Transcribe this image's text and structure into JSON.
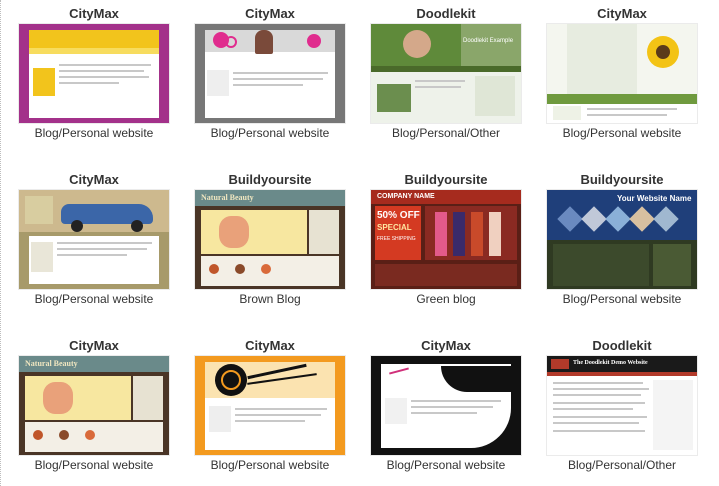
{
  "templates": [
    {
      "provider": "CityMax",
      "caption": "Blog/Personal website",
      "theme": "magenta-yellow"
    },
    {
      "provider": "CityMax",
      "caption": "Blog/Personal website",
      "theme": "gray-pink-circles"
    },
    {
      "provider": "Doodlekit",
      "caption": "Blog/Personal/Other",
      "theme": "green-photo"
    },
    {
      "provider": "CityMax",
      "caption": "Blog/Personal website",
      "theme": "green-sunflower"
    },
    {
      "provider": "CityMax",
      "caption": "Blog/Personal website",
      "theme": "olive-car"
    },
    {
      "provider": "Buildyoursite",
      "caption": "Brown Blog",
      "theme": "natural-beauty"
    },
    {
      "provider": "Buildyoursite",
      "caption": "Green blog",
      "theme": "red-sale"
    },
    {
      "provider": "Buildyoursite",
      "caption": "Blog/Personal website",
      "theme": "blue-hexagons"
    },
    {
      "provider": "CityMax",
      "caption": "Blog/Personal website",
      "theme": "natural-beauty-2"
    },
    {
      "provider": "CityMax",
      "caption": "Blog/Personal website",
      "theme": "orange-swirl"
    },
    {
      "provider": "CityMax",
      "caption": "Blog/Personal website",
      "theme": "black-wave"
    },
    {
      "provider": "Doodlekit",
      "caption": "Blog/Personal/Other",
      "theme": "doodlekit-demo"
    }
  ],
  "thumb_text": {
    "company_name": "COMPANY NAME",
    "sale_pct": "50% OFF",
    "sale_word": "SPECIAL",
    "free_shipping": "FREE SHIPPING",
    "website_name": "Your Website Name",
    "natural_beauty": "Natural Beauty",
    "doodlekit_demo": "The Doodlekit Demo Website",
    "doodlekit_example": "Doodlekit Example"
  },
  "colors": {
    "provider_text": "#333333",
    "caption_text": "#333333"
  }
}
